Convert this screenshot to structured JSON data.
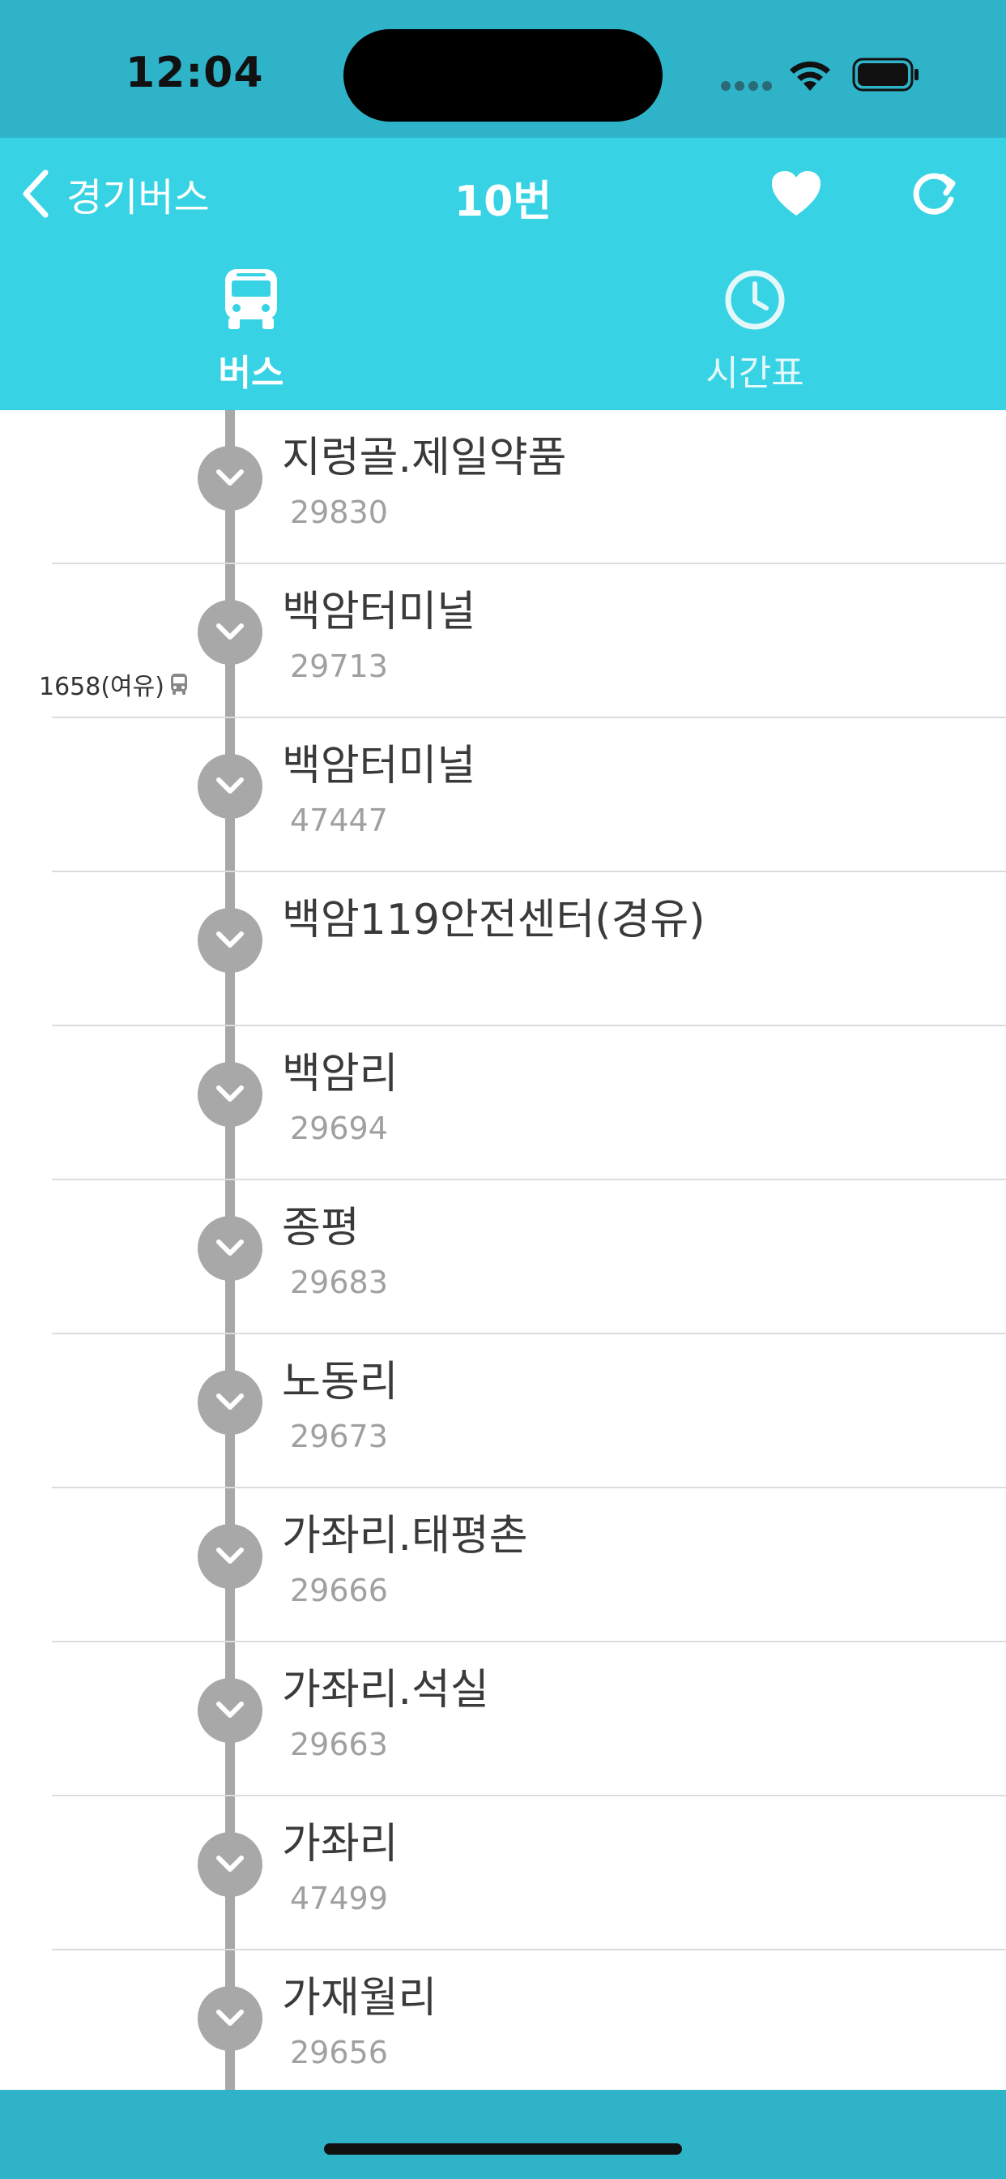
{
  "status_bar": {
    "time": "12:04"
  },
  "nav": {
    "back_label": "경기버스",
    "title": "10번",
    "tabs": [
      {
        "label": "버스",
        "icon": "bus-icon",
        "selected": true
      },
      {
        "label": "시간표",
        "icon": "clock-icon",
        "selected": false
      }
    ]
  },
  "stops": [
    {
      "name": "지렁골.제일약품",
      "id": "29830"
    },
    {
      "name": "백암터미널",
      "id": "29713"
    },
    {
      "name": "백암터미널",
      "id": "47447"
    },
    {
      "name": "백암119안전센터(경유)",
      "id": ""
    },
    {
      "name": "백암리",
      "id": "29694"
    },
    {
      "name": "종평",
      "id": "29683"
    },
    {
      "name": "노동리",
      "id": "29673"
    },
    {
      "name": "가좌리.태평촌",
      "id": "29666"
    },
    {
      "name": "가좌리.석실",
      "id": "29663"
    },
    {
      "name": "가좌리",
      "id": "47499"
    },
    {
      "name": "가재월리",
      "id": "29656"
    }
  ],
  "bus_marker": {
    "label": "1658(여유)",
    "icon": "bus-icon"
  },
  "colors": {
    "status_bar": "#2fb3c9",
    "nav_bar": "#37d3e5",
    "route_line": "#a8a8a8",
    "divider": "#dcdcdc"
  }
}
